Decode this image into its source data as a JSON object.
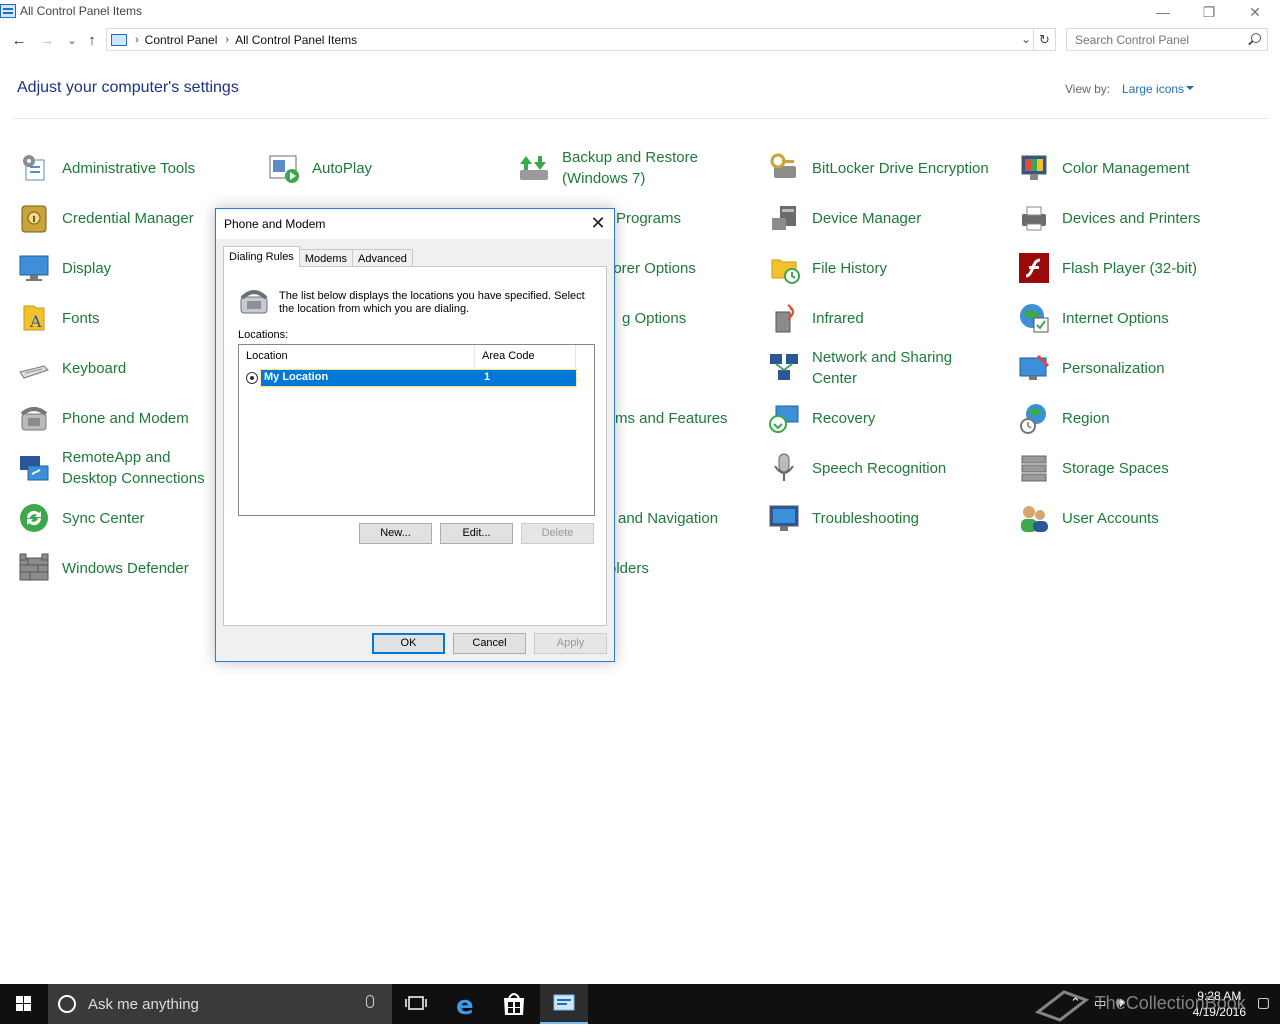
{
  "window": {
    "title": "All Control Panel Items",
    "minimize": "—",
    "restore": "❐",
    "close": "✕"
  },
  "nav": {
    "back": "←",
    "forward": "→",
    "recent": "⌄",
    "up": "↑",
    "breadcrumbs": [
      "Control Panel",
      "All Control Panel Items"
    ],
    "refresh": "↻",
    "search_placeholder": "Search Control Panel"
  },
  "header": {
    "heading": "Adjust your computer's settings",
    "view_by_label": "View by:",
    "view_by_value": "Large icons"
  },
  "items": [
    {
      "label": "Administrative Tools",
      "icon": "admin-tools-icon"
    },
    {
      "label": "AutoPlay",
      "icon": "autoplay-icon"
    },
    {
      "label": "Backup and Restore (Windows 7)",
      "icon": "backup-restore-icon"
    },
    {
      "label": "BitLocker Drive Encryption",
      "icon": "bitlocker-icon"
    },
    {
      "label": "Color Management",
      "icon": "color-management-icon"
    },
    {
      "label": "Credential Manager",
      "icon": "credential-manager-icon"
    },
    {
      "label": "Programs",
      "icon": "programs-icon"
    },
    {
      "label": "Device Manager",
      "icon": "device-manager-icon"
    },
    {
      "label": "Devices and Printers",
      "icon": "devices-printers-icon"
    },
    {
      "label": "Display",
      "icon": "display-icon"
    },
    {
      "label": "lorer Options",
      "icon": "explorer-options-icon"
    },
    {
      "label": "File History",
      "icon": "file-history-icon"
    },
    {
      "label": "Flash Player (32-bit)",
      "icon": "flash-player-icon"
    },
    {
      "label": "Fonts",
      "icon": "fonts-icon"
    },
    {
      "label": "g Options",
      "icon": "indexing-options-icon"
    },
    {
      "label": "Infrared",
      "icon": "infrared-icon"
    },
    {
      "label": "Internet Options",
      "icon": "internet-options-icon"
    },
    {
      "label": "Keyboard",
      "icon": "keyboard-icon"
    },
    {
      "label": "Network and Sharing Center",
      "icon": "network-sharing-icon"
    },
    {
      "label": "Personalization",
      "icon": "personalization-icon"
    },
    {
      "label": "Phone and Modem",
      "icon": "phone-modem-icon"
    },
    {
      "label": "ms and Features",
      "icon": "programs-features-icon"
    },
    {
      "label": "Recovery",
      "icon": "recovery-icon"
    },
    {
      "label": "Region",
      "icon": "region-icon"
    },
    {
      "label": "RemoteApp and Desktop Connections",
      "icon": "remoteapp-icon"
    },
    {
      "label": "Speech Recognition",
      "icon": "speech-recognition-icon"
    },
    {
      "label": "Storage Spaces",
      "icon": "storage-spaces-icon"
    },
    {
      "label": "Sync Center",
      "icon": "sync-center-icon"
    },
    {
      "label": "and Navigation",
      "icon": "taskbar-navigation-icon"
    },
    {
      "label": "Troubleshooting",
      "icon": "troubleshooting-icon"
    },
    {
      "label": "User Accounts",
      "icon": "user-accounts-icon"
    },
    {
      "label": "Windows Defender",
      "icon": "windows-defender-icon"
    },
    {
      "label": "olders",
      "icon": "work-folders-icon"
    }
  ],
  "dialog": {
    "title": "Phone and Modem",
    "close": "✕",
    "tabs": [
      "Dialing Rules",
      "Modems",
      "Advanced"
    ],
    "description": "The list below displays the locations you have specified. Select the location from which you are dialing.",
    "locations_label": "Locations:",
    "columns": [
      "Location",
      "Area Code"
    ],
    "rows": [
      {
        "location": "My Location",
        "area_code": "1"
      }
    ],
    "buttons": {
      "new": "New...",
      "edit": "Edit...",
      "delete": "Delete",
      "ok": "OK",
      "cancel": "Cancel",
      "apply": "Apply"
    }
  },
  "taskbar": {
    "search_text": "Ask me anything",
    "time": "9:28 AM",
    "date": "4/19/2016",
    "watermark": "TheCollectionBook"
  },
  "colors": {
    "accent": "#0078d7",
    "link_green": "#1e7a3a",
    "heading_blue": "#1e3287"
  }
}
